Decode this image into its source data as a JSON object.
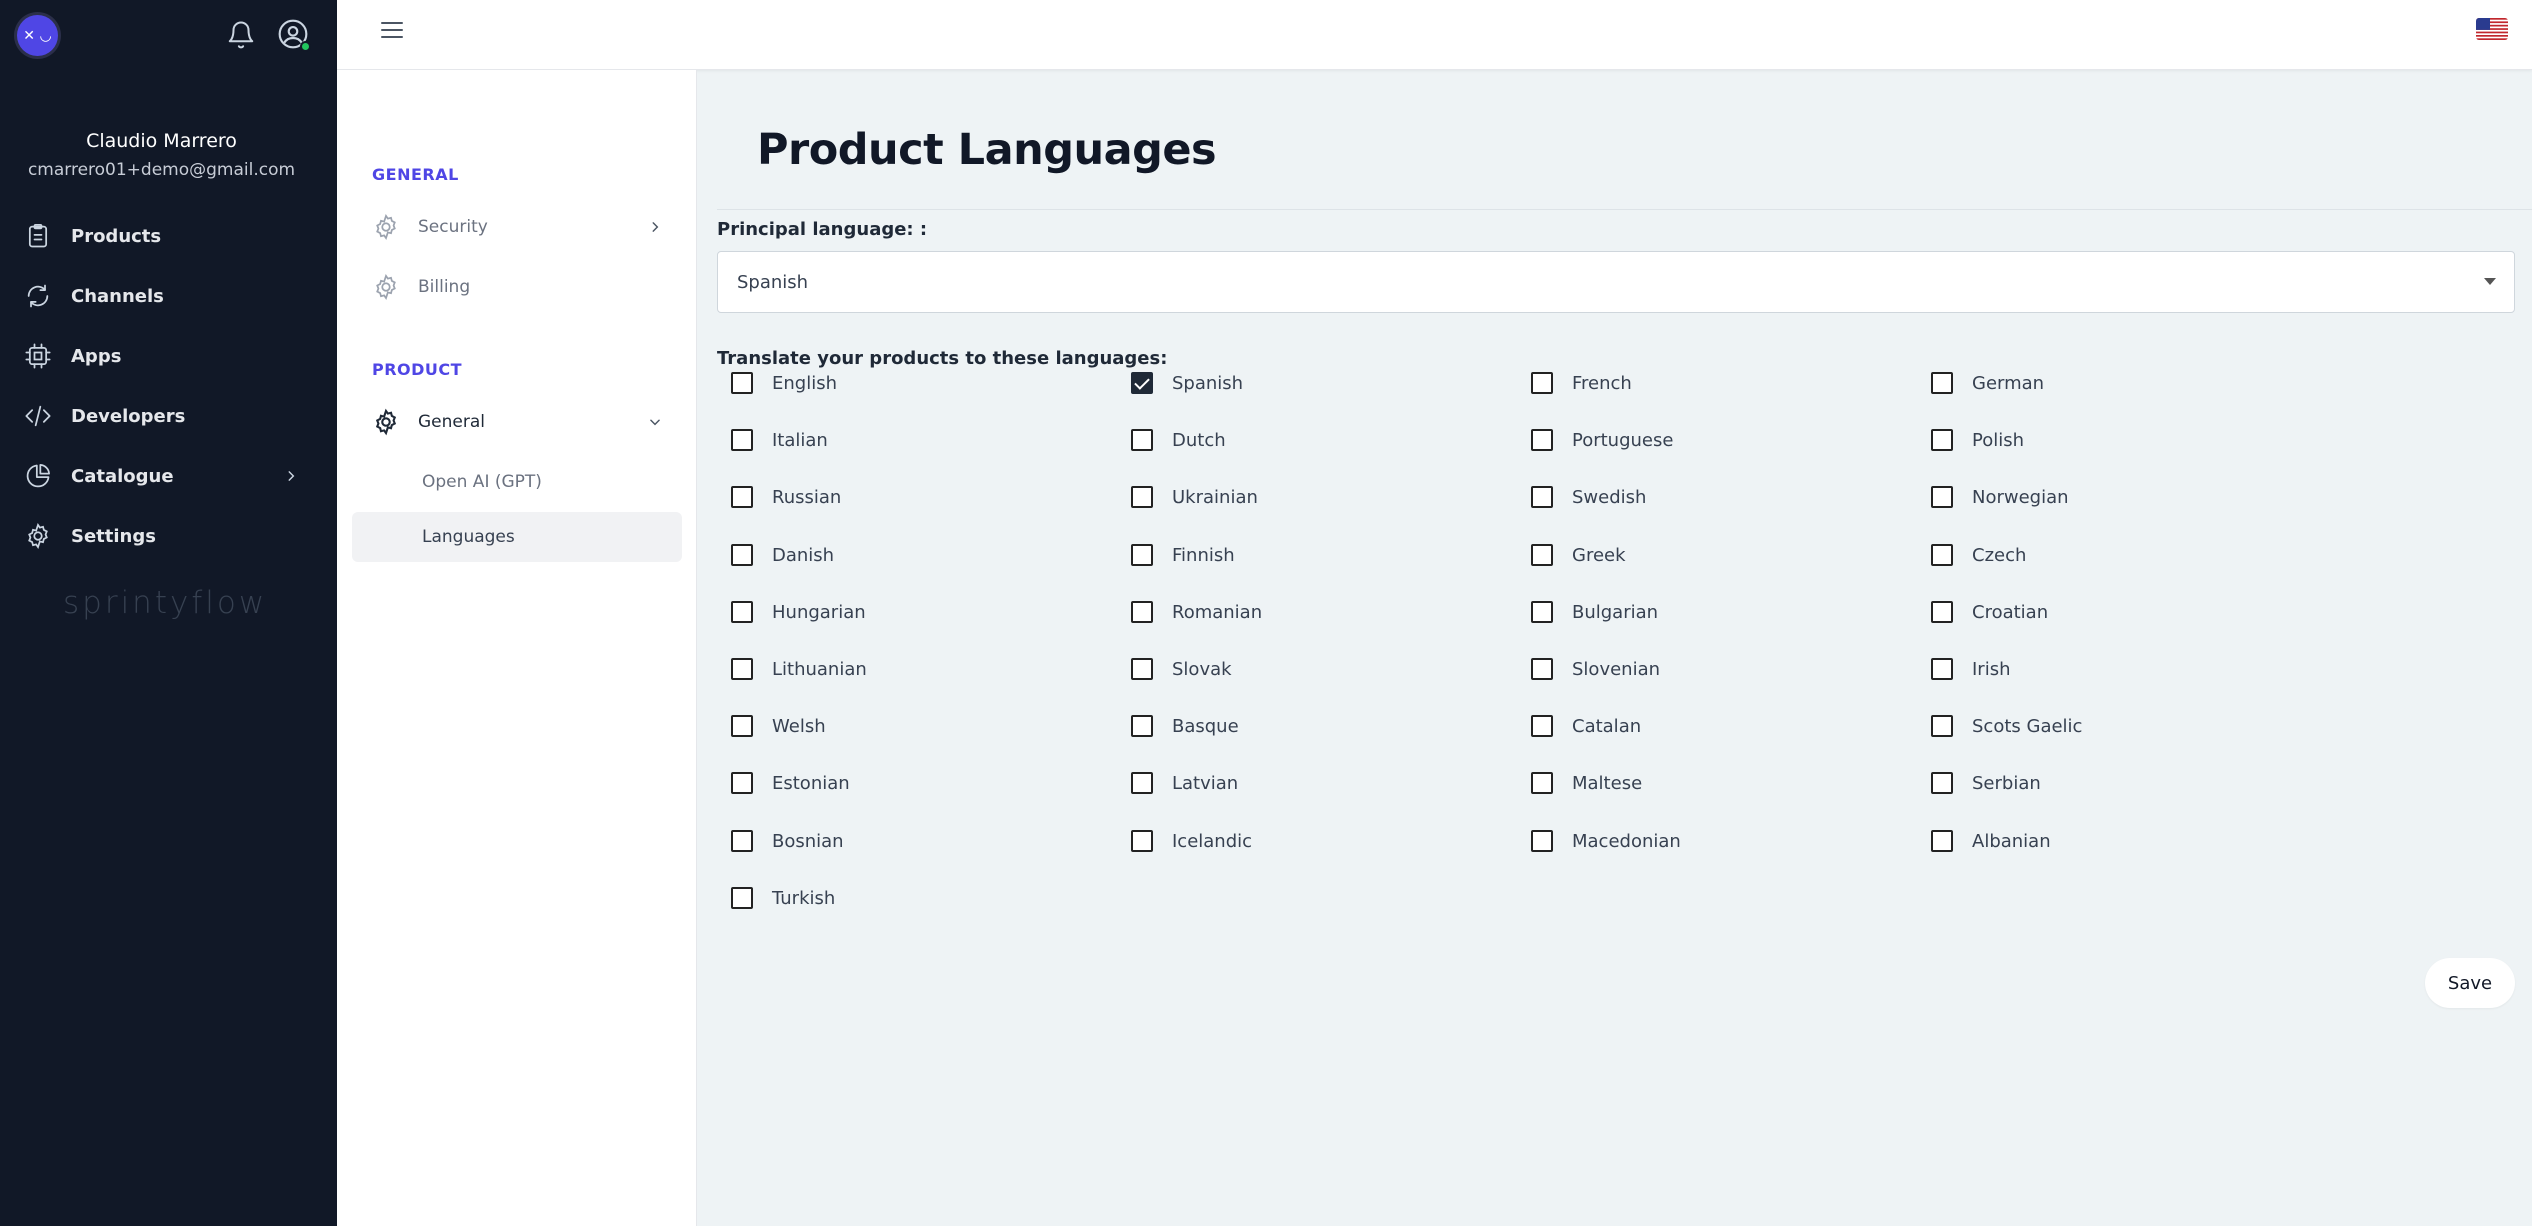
{
  "user": {
    "name": "Claudio Marrero",
    "email": "cmarrero01+demo@gmail.com"
  },
  "sidebar": {
    "brand": "sprintyflow",
    "items": [
      {
        "label": "Products",
        "icon": "clipboard-icon"
      },
      {
        "label": "Channels",
        "icon": "sync-icon"
      },
      {
        "label": "Apps",
        "icon": "chip-icon"
      },
      {
        "label": "Developers",
        "icon": "code-icon"
      },
      {
        "label": "Catalogue",
        "icon": "pie-chart-icon"
      },
      {
        "label": "Settings",
        "icon": "gear-icon"
      }
    ]
  },
  "subnav": {
    "general_title": "GENERAL",
    "security": "Security",
    "billing": "Billing",
    "product_title": "PRODUCT",
    "general": "General",
    "openai": "Open AI (GPT)",
    "languages": "Languages"
  },
  "main": {
    "title": "Product Languages",
    "principal_label": "Principal language: :",
    "principal_value": "Spanish",
    "translate_label": "Translate your products to these languages:",
    "save_label": "Save"
  },
  "languages": [
    {
      "label": "English",
      "checked": false
    },
    {
      "label": "Spanish",
      "checked": true
    },
    {
      "label": "French",
      "checked": false
    },
    {
      "label": "German",
      "checked": false
    },
    {
      "label": "Italian",
      "checked": false
    },
    {
      "label": "Dutch",
      "checked": false
    },
    {
      "label": "Portuguese",
      "checked": false
    },
    {
      "label": "Polish",
      "checked": false
    },
    {
      "label": "Russian",
      "checked": false
    },
    {
      "label": "Ukrainian",
      "checked": false
    },
    {
      "label": "Swedish",
      "checked": false
    },
    {
      "label": "Norwegian",
      "checked": false
    },
    {
      "label": "Danish",
      "checked": false
    },
    {
      "label": "Finnish",
      "checked": false
    },
    {
      "label": "Greek",
      "checked": false
    },
    {
      "label": "Czech",
      "checked": false
    },
    {
      "label": "Hungarian",
      "checked": false
    },
    {
      "label": "Romanian",
      "checked": false
    },
    {
      "label": "Bulgarian",
      "checked": false
    },
    {
      "label": "Croatian",
      "checked": false
    },
    {
      "label": "Lithuanian",
      "checked": false
    },
    {
      "label": "Slovak",
      "checked": false
    },
    {
      "label": "Slovenian",
      "checked": false
    },
    {
      "label": "Irish",
      "checked": false
    },
    {
      "label": "Welsh",
      "checked": false
    },
    {
      "label": "Basque",
      "checked": false
    },
    {
      "label": "Catalan",
      "checked": false
    },
    {
      "label": "Scots Gaelic",
      "checked": false
    },
    {
      "label": "Estonian",
      "checked": false
    },
    {
      "label": "Latvian",
      "checked": false
    },
    {
      "label": "Maltese",
      "checked": false
    },
    {
      "label": "Serbian",
      "checked": false
    },
    {
      "label": "Bosnian",
      "checked": false
    },
    {
      "label": "Icelandic",
      "checked": false
    },
    {
      "label": "Macedonian",
      "checked": false
    },
    {
      "label": "Albanian",
      "checked": false
    },
    {
      "label": "Turkish",
      "checked": false
    }
  ]
}
